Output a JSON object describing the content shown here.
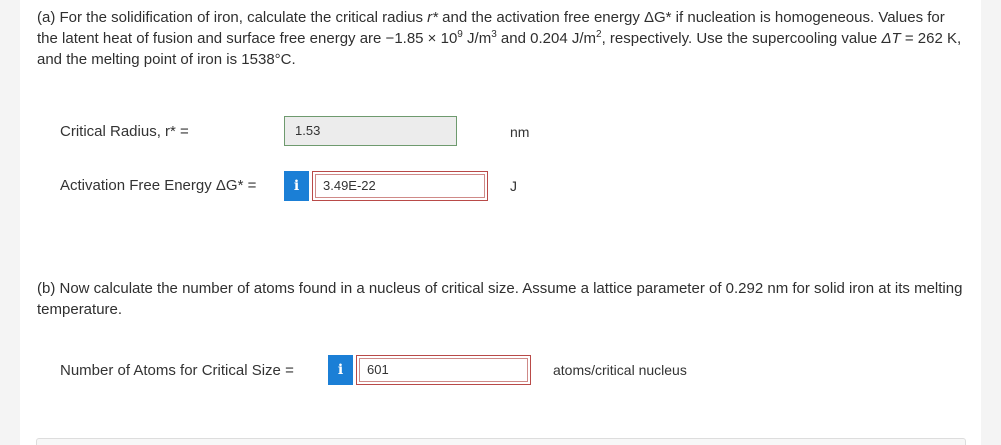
{
  "part_a": {
    "line1_pre": "(a) For the solidification of iron, calculate the critical radius ",
    "r_symbol": "r*",
    "line1_mid": " and the activation free energy ",
    "dg_symbol": "ΔG*",
    "line1_post": " if nucleation is homogeneous. Values for the latent heat of fusion and surface free energy are −1.85 × 10",
    "exp9": "9",
    "unit_jm": " J/m",
    "exp3": "3",
    "and_text": " and 0.204 J/m",
    "exp2": "2",
    "tail": ", respectively. Use the supercooling value ",
    "dt_symbol": "ΔT",
    "tail2": " = 262 K, and the melting point of iron is 1538°C."
  },
  "critical_radius": {
    "label": "Critical Radius, r* =",
    "value": "1.53",
    "unit": "nm",
    "status": "correct"
  },
  "activation_energy": {
    "label": "Activation Free Energy ΔG* =",
    "info_icon": "i",
    "value": "3.49E-22",
    "unit": "J",
    "status": "incorrect"
  },
  "part_b": {
    "text": "(b) Now calculate the number of atoms found in a nucleus of critical size. Assume a lattice parameter of 0.292 nm for solid iron at its melting temperature."
  },
  "atoms_count": {
    "label": "Number of Atoms for Critical Size =",
    "info_icon": "i",
    "value": "601",
    "unit": "atoms/critical nucleus",
    "status": "incorrect"
  },
  "colors": {
    "info_button": "#1b7fd6",
    "correct_border": "#6e9a6e",
    "incorrect_border": "#b94a48"
  }
}
